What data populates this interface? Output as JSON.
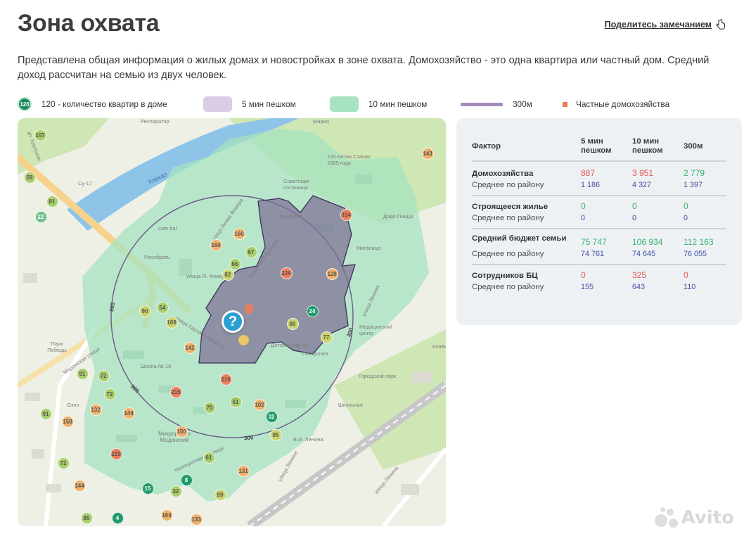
{
  "header": {
    "title": "Зона охвата",
    "share_label": "Поделитесь замечанием"
  },
  "description": "Представлена общая информация о жилых домах и новостройках в зоне охвата. Домохозяйство - это одна квартира или частный дом. Средний доход рассчитан на семью из двух человек.",
  "legend": {
    "badge_value": "120",
    "badge_label": "120 - количество квартир в доме",
    "walk5_label": "5 мин пешком",
    "walk10_label": "10 мин пешком",
    "radius_label": "300м",
    "private_label": "Частные домохозяйства"
  },
  "colors": {
    "walk5": "#d9cde3",
    "walk10": "#a6e3c0",
    "radius": "#a58bc0",
    "private": "#e77b54",
    "badge": "#1e8a63",
    "value_red": "#e45b4f",
    "value_green": "#34b36f",
    "avg_blue": "#3e4fa0"
  },
  "map": {
    "street_labels": [
      "Респиратор",
      "ул. Крупская",
      "Кавказ",
      "Су-17",
      "улица Якова Флиера",
      "cafe bar",
      "Рособрать",
      "улица Я. Флиера",
      "Советская гостиница",
      "100-летия Стачки 1885 года",
      "Пиццерия",
      "Мигалица",
      "Додо Пицца",
      "улица Ленина",
      "Медицинский центр",
      "Детский сад №",
      "Пятёрочка",
      "Городской парк",
      "Школьная",
      "Школа № 16",
      "Озон",
      "Мадонская улица",
      "Парк Победы",
      "Кооперативная улица",
      "улица Ленина",
      "улица Ленина",
      "В.И. Ленина",
      "улица Карла Либкнехта",
      "Марио",
      "Микрорайон Мадонский",
      "Ленинский бульвар",
      "Конёк"
    ],
    "distance_label": "300",
    "center_icon": "?",
    "markers": [
      "107",
      "59",
      "81",
      "22",
      "160",
      "160",
      "67",
      "66",
      "82",
      "226",
      "128",
      "24",
      "80",
      "77",
      "90",
      "54",
      "109",
      "142",
      "91",
      "72",
      "72",
      "132",
      "91",
      "158",
      "144",
      "215",
      "70",
      "51",
      "102",
      "32",
      "95",
      "216",
      "150",
      "61",
      "215",
      "72",
      "72",
      "144",
      "131",
      "15",
      "32",
      "8",
      "99",
      "85",
      "4",
      "164",
      "133",
      "314",
      "143"
    ]
  },
  "stats": {
    "columns": [
      "Фактор",
      "5 мин пешком",
      "10 мин пешком",
      "300м"
    ],
    "avg_label": "Среднее по району",
    "rows": [
      {
        "factor": "Домохозяйства",
        "values": [
          "887",
          "3 951",
          "2 779"
        ],
        "avg": [
          "1 186",
          "4 327",
          "1 397"
        ]
      },
      {
        "factor": "Строящееся жилье",
        "values": [
          "0",
          "0",
          "0"
        ],
        "avg": [
          "0",
          "0",
          "0"
        ]
      },
      {
        "factor": "Средний бюджет семьи",
        "values": [
          "75 747",
          "106 934",
          "112 163"
        ],
        "avg": [
          "74 761",
          "74 645",
          "76 055"
        ]
      },
      {
        "factor": "Сотрудников БЦ",
        "values": [
          "0",
          "325",
          "0"
        ],
        "avg": [
          "155",
          "643",
          "110"
        ]
      }
    ]
  },
  "watermark": "Avito"
}
